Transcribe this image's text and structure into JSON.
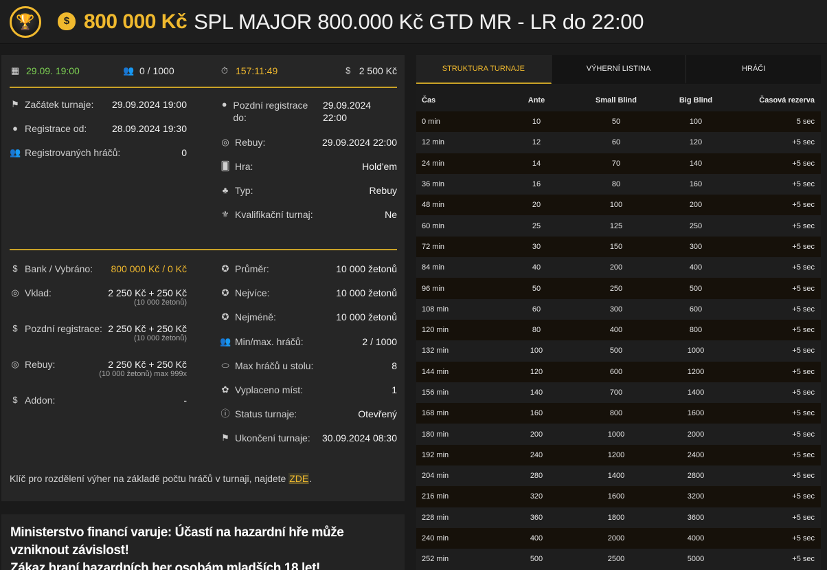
{
  "header": {
    "prize": "800 000 Kč",
    "title": "SPL MAJOR 800.000 Kč GTD MR - LR do 22:00"
  },
  "topstats": {
    "date": "29.09. 19:00",
    "players": "0 / 1000",
    "timer": "157:11:49",
    "buyin": "2 500 Kč"
  },
  "info_left": [
    {
      "icon": "flag-icon",
      "label": "Začátek turnaje:",
      "value": "29.09.2024 19:00"
    },
    {
      "icon": "user-icon",
      "label": "Registrace od:",
      "value": "28.09.2024 19:30"
    },
    {
      "icon": "users-icon",
      "label": "Registrovaných hráčů:",
      "value": "0"
    }
  ],
  "info_right": [
    {
      "icon": "user-icon",
      "label": "Pozdní registrace do:",
      "value": "29.09.2024 22:00"
    },
    {
      "icon": "coins-icon",
      "label": "Rebuy:",
      "value": "29.09.2024 22:00"
    },
    {
      "icon": "cards-icon",
      "label": "Hra:",
      "value": "Hold'em"
    },
    {
      "icon": "suits-icon",
      "label": "Typ:",
      "value": "Rebuy"
    },
    {
      "icon": "medal-icon",
      "label": "Kvalifikační turnaj:",
      "value": "Ne"
    }
  ],
  "money_left": [
    {
      "icon": "bag-icon",
      "label": "Bank / Vybráno:",
      "value": "800 000 Kč / 0 Kč",
      "sub": ""
    },
    {
      "icon": "coins-icon",
      "label": "Vklad:",
      "value": "2 250 Kč + 250 Kč",
      "sub": "(10 000 žetonů)"
    },
    {
      "icon": "dollar-icon",
      "label": "Pozdní registrace:",
      "value": "2 250 Kč + 250 Kč",
      "sub": "(10 000 žetonů)"
    },
    {
      "icon": "coins-icon",
      "label": "Rebuy:",
      "value": "2 250 Kč + 250 Kč",
      "sub": "(10 000 žetonů) max 999x"
    },
    {
      "icon": "dollar-icon",
      "label": "Addon:",
      "value": "-",
      "sub": ""
    }
  ],
  "money_right": [
    {
      "icon": "chip-icon",
      "label": "Průměr:",
      "value": "10 000 žetonů"
    },
    {
      "icon": "chip-icon",
      "label": "Nejvíce:",
      "value": "10 000 žetonů"
    },
    {
      "icon": "chip-icon",
      "label": "Nejméně:",
      "value": "10 000 žetonů"
    },
    {
      "icon": "users-icon",
      "label": "Min/max. hráčů:",
      "value": "2 / 1000"
    },
    {
      "icon": "table-icon",
      "label": "Max hráčů u stolu:",
      "value": "8"
    },
    {
      "icon": "award-icon",
      "label": "Vyplaceno míst:",
      "value": "1"
    },
    {
      "icon": "info-icon",
      "label": "Status turnaje:",
      "value": "Otevřený"
    },
    {
      "icon": "flag-icon",
      "label": "Ukončení turnaje:",
      "value": "30.09.2024 08:30"
    }
  ],
  "note": {
    "text": "Klíč pro rozdělení výher na základě počtu hráčů v turnaji, najdete ",
    "link": "ZDE",
    "end": "."
  },
  "warning": {
    "line1": "Ministerstvo financí varuje: Účastí na hazardní hře může vzniknout závislost!",
    "line2": "Zákaz hraní hazardních her osobám mladších 18 let!"
  },
  "tabs": [
    "STRUKTURA TURNAJE",
    "VÝHERNÍ LISTINA",
    "HRÁČI"
  ],
  "structure": {
    "headers": [
      "Čas",
      "Ante",
      "Small Blind",
      "Big Blind",
      "Časová rezerva"
    ],
    "rows": [
      [
        "0 min",
        "10",
        "50",
        "100",
        "5 sec"
      ],
      [
        "12 min",
        "12",
        "60",
        "120",
        "+5 sec"
      ],
      [
        "24 min",
        "14",
        "70",
        "140",
        "+5 sec"
      ],
      [
        "36 min",
        "16",
        "80",
        "160",
        "+5 sec"
      ],
      [
        "48 min",
        "20",
        "100",
        "200",
        "+5 sec"
      ],
      [
        "60 min",
        "25",
        "125",
        "250",
        "+5 sec"
      ],
      [
        "72 min",
        "30",
        "150",
        "300",
        "+5 sec"
      ],
      [
        "84 min",
        "40",
        "200",
        "400",
        "+5 sec"
      ],
      [
        "96 min",
        "50",
        "250",
        "500",
        "+5 sec"
      ],
      [
        "108 min",
        "60",
        "300",
        "600",
        "+5 sec"
      ],
      [
        "120 min",
        "80",
        "400",
        "800",
        "+5 sec"
      ],
      [
        "132 min",
        "100",
        "500",
        "1000",
        "+5 sec"
      ],
      [
        "144 min",
        "120",
        "600",
        "1200",
        "+5 sec"
      ],
      [
        "156 min",
        "140",
        "700",
        "1400",
        "+5 sec"
      ],
      [
        "168 min",
        "160",
        "800",
        "1600",
        "+5 sec"
      ],
      [
        "180 min",
        "200",
        "1000",
        "2000",
        "+5 sec"
      ],
      [
        "192 min",
        "240",
        "1200",
        "2400",
        "+5 sec"
      ],
      [
        "204 min",
        "280",
        "1400",
        "2800",
        "+5 sec"
      ],
      [
        "216 min",
        "320",
        "1600",
        "3200",
        "+5 sec"
      ],
      [
        "228 min",
        "360",
        "1800",
        "3600",
        "+5 sec"
      ],
      [
        "240 min",
        "400",
        "2000",
        "4000",
        "+5 sec"
      ],
      [
        "252 min",
        "500",
        "2500",
        "5000",
        "+5 sec"
      ]
    ]
  },
  "colors": {
    "accent": "#f0b92e",
    "green": "#7ccf52",
    "gold_line": "#c9a227"
  }
}
